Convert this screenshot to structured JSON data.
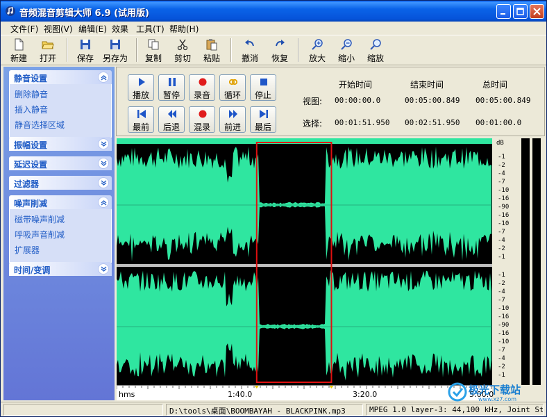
{
  "window": {
    "title": "音频混音剪辑大师 6.9 (试用版)"
  },
  "menu": [
    {
      "label": "文件(F)"
    },
    {
      "label": "视图(V)"
    },
    {
      "label": "编辑(E)"
    },
    {
      "label": "效果"
    },
    {
      "label": "工具(T)"
    },
    {
      "label": "帮助(H)"
    }
  ],
  "toolbar": {
    "new_label": "新建",
    "open_label": "打开",
    "save_label": "保存",
    "saveas_label": "另存为",
    "copy_label": "复制",
    "cut_label": "剪切",
    "paste_label": "粘贴",
    "undo_label": "撤消",
    "redo_label": "恢复",
    "zoomin_label": "放大",
    "zoomout_label": "缩小",
    "zoomfit_label": "缩放"
  },
  "sidebar": {
    "silence": {
      "title": "静音设置",
      "items": [
        "删除静音",
        "插入静音",
        "静音选择区域"
      ]
    },
    "amplitude": {
      "title": "振幅设置"
    },
    "delay": {
      "title": "延迟设置"
    },
    "filter": {
      "title": "过滤器"
    },
    "noise": {
      "title": "噪声削减",
      "items": [
        "磁带噪声削减",
        "呼吸声音削减",
        "扩展器"
      ]
    },
    "time": {
      "title": "时间/变调"
    }
  },
  "playback": {
    "play": "播放",
    "pause": "暂停",
    "record": "录音",
    "loop": "循环",
    "stop": "停止",
    "first": "最前",
    "back": "后退",
    "mix_record": "混录",
    "forward": "前进",
    "last": "最后"
  },
  "times": {
    "header_start": "开始时间",
    "header_end": "结束时间",
    "header_total": "总时间",
    "view_label": "视图:",
    "select_label": "选择:",
    "view_start": "00:00:00.0",
    "view_end": "00:05:00.849",
    "view_total": "00:05:00.849",
    "select_start": "00:01:51.950",
    "select_end": "00:02:51.950",
    "select_total": "00:01:00.0"
  },
  "db_scale": {
    "unit": "dB",
    "ticks": [
      "-1",
      "-2",
      "-4",
      "-7",
      "-10",
      "-16",
      "-90",
      "-16",
      "-10",
      "-7",
      "-4",
      "-2",
      "-1"
    ]
  },
  "timeline": {
    "unit": "hms",
    "labels": [
      "1:40.0",
      "3:20.0",
      "5:00.0"
    ]
  },
  "selection": {
    "start_fraction": 0.373,
    "end_fraction": 0.572
  },
  "statusbar": {
    "file": "D:\\tools\\桌面\\BOOMBAYAH - BLACKPINK.mp3",
    "format": "MPEG 1.0 layer-3: 44,100 kHz, Joint Stereo"
  },
  "watermark": {
    "text": "极光下载站",
    "url": "www.xz7.com"
  },
  "colors": {
    "wave": "#2fe6a0",
    "selection_border": "#e01010",
    "title_bar": "#0a63e8"
  }
}
